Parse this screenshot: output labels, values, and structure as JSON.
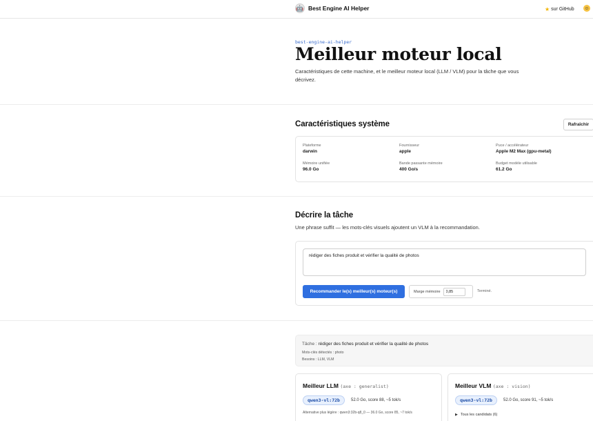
{
  "header": {
    "brand": "Best Engine AI Helper",
    "github_link": "sur GitHub"
  },
  "hero": {
    "eyebrow": "best-engine-ai-helper",
    "title": "Meilleur moteur local",
    "subtitle": "Caractéristiques de cette machine, et le meilleur moteur local (LLM / VLM) pour la tâche que vous décrivez."
  },
  "system": {
    "title": "Caractéristiques système",
    "refresh_label": "Rafraîchir",
    "specs": [
      {
        "label": "Plateforme",
        "value": "darwin"
      },
      {
        "label": "Fournisseur",
        "value": "apple"
      },
      {
        "label": "Puce / accélérateur",
        "value": "Apple M2 Max (gpu-metal)"
      },
      {
        "label": "Mémoire unifiée",
        "value": "96.0 Go"
      },
      {
        "label": "Bande passante mémoire",
        "value": "400 Go/s"
      },
      {
        "label": "Budget modèle utilisable",
        "value": "61.2 Go"
      }
    ]
  },
  "task": {
    "title": "Décrire la tâche",
    "hint": "Une phrase suffit — les mots-clés visuels ajoutent un VLM à la recommandation.",
    "input_value": "rédiger des fiches produit et vérifier la qualité de photos",
    "recommend_label": "Recommander le(s) meilleur(s) moteur(s)",
    "margin_label": "Marge mémoire",
    "margin_value": "0,85",
    "status": "Terminé."
  },
  "result": {
    "task_key": "Tâche :",
    "task_value": "rédiger des fiches produit et vérifier la qualité de photos",
    "keywords": "Mots-clés détectés : photo",
    "needs": "Besoins : LLM, VLM",
    "llm": {
      "title": "Meilleur LLM",
      "axis": "(axe : generalist)",
      "model": "qwen3-vl:72b",
      "stats": "52.0 Go, score 88, ~5 tok/s",
      "alternative": "Alternative plus légère : qwen3:32b-q8_0 — 36.0 Go, score 85, ~7 tok/s"
    },
    "vlm": {
      "title": "Meilleur VLM",
      "axis": "(axe : vision)",
      "model": "qwen3-vl:72b",
      "stats": "52.0 Go, score 91, ~5 tok/s",
      "candidates": "Tous les candidats (6)"
    }
  },
  "colors": {
    "accent": "#2f6fe0",
    "pill_bg": "#e8f0fd",
    "pill_text": "#1f4fa8",
    "eyebrow": "#3a6ccc"
  },
  "icons": {
    "brand": "robot-logo-icon",
    "github": "star-icon",
    "avatar": "smiley-avatar-icon",
    "candidates": "disclosure-triangle-icon"
  }
}
